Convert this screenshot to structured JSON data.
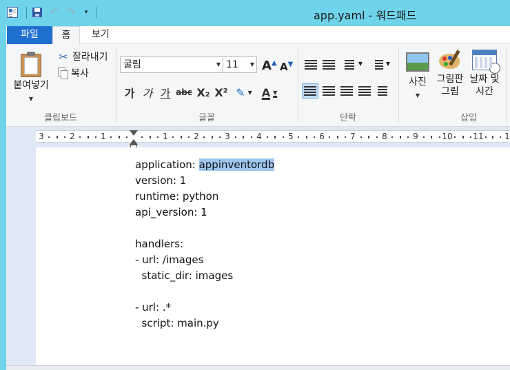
{
  "window": {
    "title": "app.yaml - 워드패드"
  },
  "quick_access": {
    "undo_glyph": "↶",
    "redo_glyph": "↷",
    "dropdown_glyph": "▾"
  },
  "tabs": [
    {
      "label": "파일"
    },
    {
      "label": "홈"
    },
    {
      "label": "보기"
    }
  ],
  "ribbon": {
    "clipboard": {
      "paste_label": "붙여넣기",
      "cut_label": "잘라내기",
      "copy_label": "복사",
      "group_label": "클립보드"
    },
    "font": {
      "font_family": "굴림",
      "font_size": "11",
      "grow_glyph": "A",
      "shrink_glyph": "A",
      "bold_glyph": "가",
      "italic_glyph": "가",
      "underline_glyph": "가",
      "strike_glyph": "abc",
      "subscript_glyph": "X₂",
      "superscript_glyph": "X²",
      "highlight_glyph": "✎",
      "color_glyph": "A",
      "group_label": "글꼴"
    },
    "paragraph": {
      "group_label": "단락"
    },
    "insert": {
      "picture_label": "사진",
      "paint_label_1": "그림판",
      "paint_label_2": "그림",
      "datetime_label_1": "날짜 및",
      "datetime_label_2": "시간",
      "group_label": "삽입"
    },
    "colors": {
      "file_tab": "#1e6fd0",
      "titlebar": "#6fd3ea",
      "selection": "#9ec6ef"
    }
  },
  "ruler": {
    "labels": [
      "3",
      "2",
      "1",
      "1",
      "2",
      "3",
      "4",
      "5",
      "6",
      "7",
      "8",
      "9",
      "10",
      "11",
      "1"
    ]
  },
  "document": {
    "lines": [
      {
        "text": "application: ",
        "highlight": "appinventordb"
      },
      {
        "text": "version: 1"
      },
      {
        "text": "runtime: python"
      },
      {
        "text": "api_version: 1"
      },
      {
        "text": ""
      },
      {
        "text": "handlers:"
      },
      {
        "text": "- url: /images"
      },
      {
        "text": "  static_dir: images"
      },
      {
        "text": ""
      },
      {
        "text": "- url: .*"
      },
      {
        "text": "  script: main.py"
      }
    ]
  }
}
